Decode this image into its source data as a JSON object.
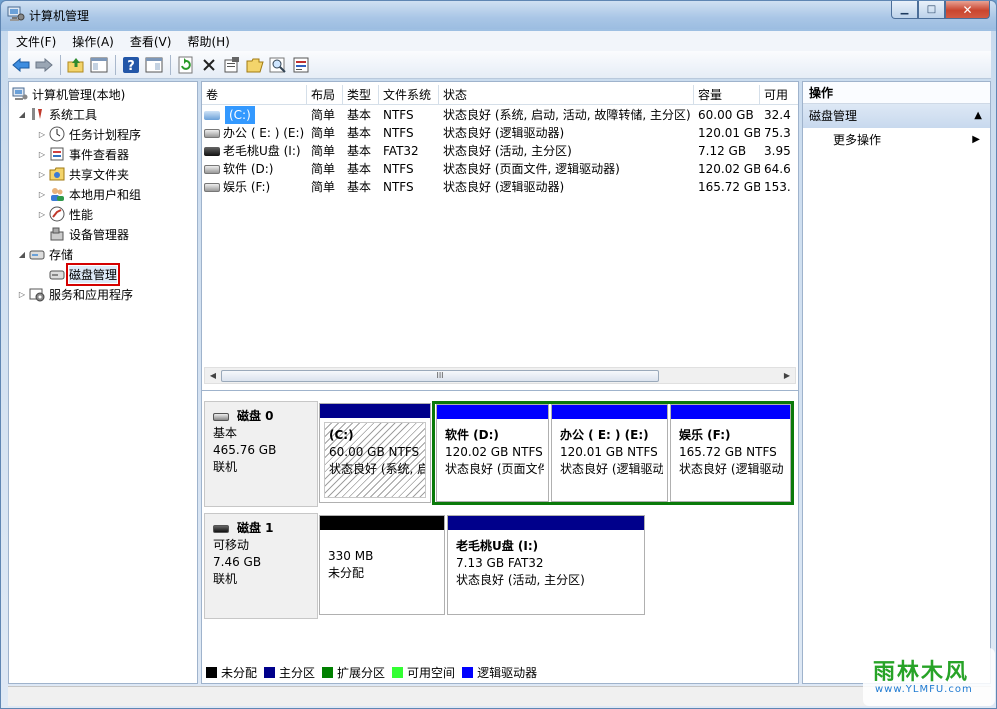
{
  "window": {
    "title": "计算机管理"
  },
  "menu": [
    "文件(F)",
    "操作(A)",
    "查看(V)",
    "帮助(H)"
  ],
  "toolbar": [
    "back-icon",
    "forward-icon",
    "up-icon",
    "show-hide-tree-icon",
    "help-icon",
    "show-hide-action-icon",
    "refresh-icon",
    "delete-icon",
    "properties-icon",
    "open-icon",
    "search-icon",
    "export-icon"
  ],
  "tree": {
    "root": "计算机管理(本地)",
    "system_tools": "系统工具",
    "task_scheduler": "任务计划程序",
    "event_viewer": "事件查看器",
    "shared_folders": "共享文件夹",
    "local_users": "本地用户和组",
    "performance": "性能",
    "device_manager": "设备管理器",
    "storage": "存储",
    "disk_management": "磁盘管理",
    "services_apps": "服务和应用程序"
  },
  "volume_table": {
    "headers": [
      "卷",
      "布局",
      "类型",
      "文件系统",
      "状态",
      "容量",
      "可用"
    ],
    "rows": [
      [
        "(C:)",
        "简单",
        "基本",
        "NTFS",
        "状态良好 (系统, 启动, 活动, 故障转储, 主分区)",
        "60.00 GB",
        "32.4"
      ],
      [
        "办公 ( E: )  (E:)",
        "简单",
        "基本",
        "NTFS",
        "状态良好 (逻辑驱动器)",
        "120.01 GB",
        "75.3"
      ],
      [
        "老毛桃U盘 (I:)",
        "简单",
        "基本",
        "FAT32",
        "状态良好 (活动, 主分区)",
        "7.12 GB",
        "3.95"
      ],
      [
        "软件 (D:)",
        "简单",
        "基本",
        "NTFS",
        "状态良好 (页面文件, 逻辑驱动器)",
        "120.02 GB",
        "64.6"
      ],
      [
        "娱乐 (F:)",
        "简单",
        "基本",
        "NTFS",
        "状态良好 (逻辑驱动器)",
        "165.72 GB",
        "153."
      ]
    ]
  },
  "scrollbar": {
    "thumb_grip": "III"
  },
  "disk0": {
    "name": "磁盘 0",
    "type": "基本",
    "size": "465.76 GB",
    "status": "联机",
    "partitions": [
      {
        "title": "(C:)",
        "size": "60.00 GB NTFS",
        "status": "状态良好 (系统, 启"
      },
      {
        "title": "软件  (D:)",
        "size": "120.02 GB NTFS",
        "status": "状态良好 (页面文件"
      },
      {
        "title": "办公 ( E: )   (E:)",
        "size": "120.01 GB NTFS",
        "status": "状态良好 (逻辑驱动"
      },
      {
        "title": "娱乐  (F:)",
        "size": "165.72 GB NTFS",
        "status": "状态良好 (逻辑驱动"
      }
    ]
  },
  "disk1": {
    "name": "磁盘 1",
    "type": "可移动",
    "size": "7.46 GB",
    "status": "联机",
    "partitions": [
      {
        "size": "330 MB",
        "status": "未分配"
      },
      {
        "title": "老毛桃U盘  (I:)",
        "size": "7.13 GB FAT32",
        "status": "状态良好 (活动, 主分区)"
      }
    ]
  },
  "legend": [
    {
      "label": "未分配",
      "color": "#000000"
    },
    {
      "label": "主分区",
      "color": "#00008b"
    },
    {
      "label": "扩展分区",
      "color": "#008000"
    },
    {
      "label": "可用空间",
      "color": "#33ff33"
    },
    {
      "label": "逻辑驱动器",
      "color": "#0000ff"
    }
  ],
  "actions": {
    "title": "操作",
    "section": "磁盘管理",
    "more": "更多操作"
  },
  "watermark": {
    "text": "雨林木风",
    "url": "www.YLMFU.com"
  }
}
